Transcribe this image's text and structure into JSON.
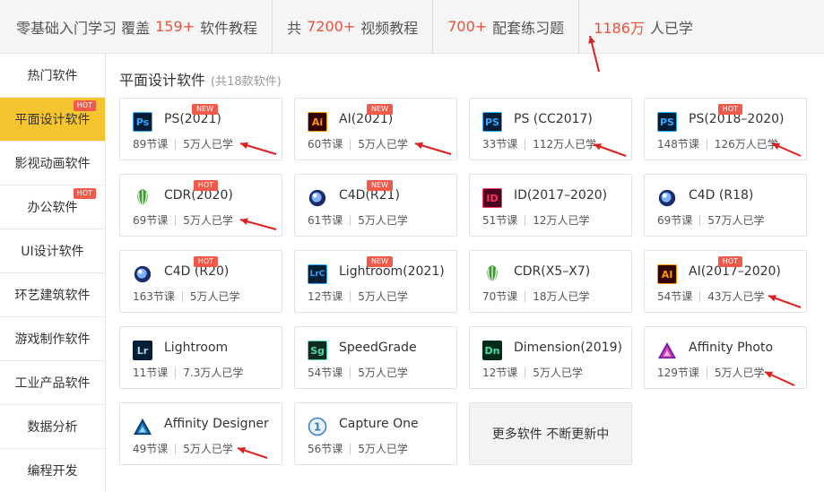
{
  "topbar": {
    "s1_prefix": "零基础入门学习 覆盖",
    "s1_num": "159+",
    "s1_suffix": "软件教程",
    "s2_prefix": "共",
    "s2_num": "7200+",
    "s2_suffix": "视频教程",
    "s3_num": "700+",
    "s3_suffix": "配套练习题",
    "s4_num": "1186万",
    "s4_suffix": "人已学",
    "highlight_color": "#e8533b"
  },
  "sidebar": {
    "items": [
      {
        "label": "热门软件"
      },
      {
        "label": "平面设计软件",
        "badge": "HOT",
        "active": true
      },
      {
        "label": "影视动画软件"
      },
      {
        "label": "办公软件",
        "badge": "HOT"
      },
      {
        "label": "UI设计软件"
      },
      {
        "label": "环艺建筑软件"
      },
      {
        "label": "游戏制作软件"
      },
      {
        "label": "工业产品软件"
      },
      {
        "label": "数据分析"
      },
      {
        "label": "编程开发"
      }
    ],
    "active_color": "#f5c530"
  },
  "section": {
    "title": "平面设计软件",
    "count": "(共18款软件)"
  },
  "cards": [
    {
      "name": "PS(2021)",
      "lessons": "89节课",
      "learners": "5万人已学",
      "badge": "NEW",
      "icon": "ps-icon",
      "logo": "Ps"
    },
    {
      "name": "AI(2021)",
      "lessons": "60节课",
      "learners": "5万人已学",
      "badge": "NEW",
      "icon": "ai-icon",
      "logo": "Ai"
    },
    {
      "name": "PS (CC2017)",
      "lessons": "33节课",
      "learners": "112万人已学",
      "icon": "ps-icon",
      "logo": "PS"
    },
    {
      "name": "PS(2018–2020)",
      "lessons": "148节课",
      "learners": "126万人已学",
      "badge": "HOT",
      "icon": "ps-icon",
      "logo": "PS"
    },
    {
      "name": "CDR(2020)",
      "lessons": "69节课",
      "learners": "5万人已学",
      "badge": "HOT",
      "icon": "cdr-icon"
    },
    {
      "name": "C4D(R21)",
      "lessons": "61节课",
      "learners": "5万人已学",
      "badge": "NEW",
      "icon": "c4d-icon"
    },
    {
      "name": "ID(2017–2020)",
      "lessons": "51节课",
      "learners": "12万人已学",
      "icon": "id-icon",
      "logo": "ID"
    },
    {
      "name": "C4D (R18)",
      "lessons": "69节课",
      "learners": "57万人已学",
      "icon": "c4d-icon"
    },
    {
      "name": "C4D (R20)",
      "lessons": "163节课",
      "learners": "5万人已学",
      "badge": "HOT",
      "icon": "c4d-icon"
    },
    {
      "name": "Lightroom(2021)",
      "lessons": "12节课",
      "learners": "5万人已学",
      "badge": "NEW",
      "icon": "lrc-icon",
      "logo": "LrC"
    },
    {
      "name": "CDR(X5–X7)",
      "lessons": "70节课",
      "learners": "18万人已学",
      "icon": "cdr-icon"
    },
    {
      "name": "AI(2017–2020)",
      "lessons": "54节课",
      "learners": "43万人已学",
      "badge": "HOT",
      "icon": "ai-icon",
      "logo": "AI"
    },
    {
      "name": "Lightroom",
      "lessons": "11节课",
      "learners": "7.3万人已学",
      "icon": "lr-icon",
      "logo": "Lr"
    },
    {
      "name": "SpeedGrade",
      "lessons": "54节课",
      "learners": "5万人已学",
      "icon": "sg-icon",
      "logo": "Sg"
    },
    {
      "name": "Dimension(2019)",
      "lessons": "12节课",
      "learners": "5万人已学",
      "icon": "dn-icon",
      "logo": "Dn"
    },
    {
      "name": "Affinity Photo",
      "lessons": "129节课",
      "learners": "5万人已学",
      "icon": "affinity-photo-icon"
    },
    {
      "name": "Affinity Designer",
      "lessons": "49节课",
      "learners": "5万人已学",
      "icon": "affinity-designer-icon"
    },
    {
      "name": "Capture One",
      "lessons": "56节课",
      "learners": "5万人已学",
      "icon": "capture-one-icon",
      "logo": "1"
    }
  ],
  "more_card": {
    "label": "更多软件 不断更新中"
  },
  "annotation_color": "#e02020"
}
